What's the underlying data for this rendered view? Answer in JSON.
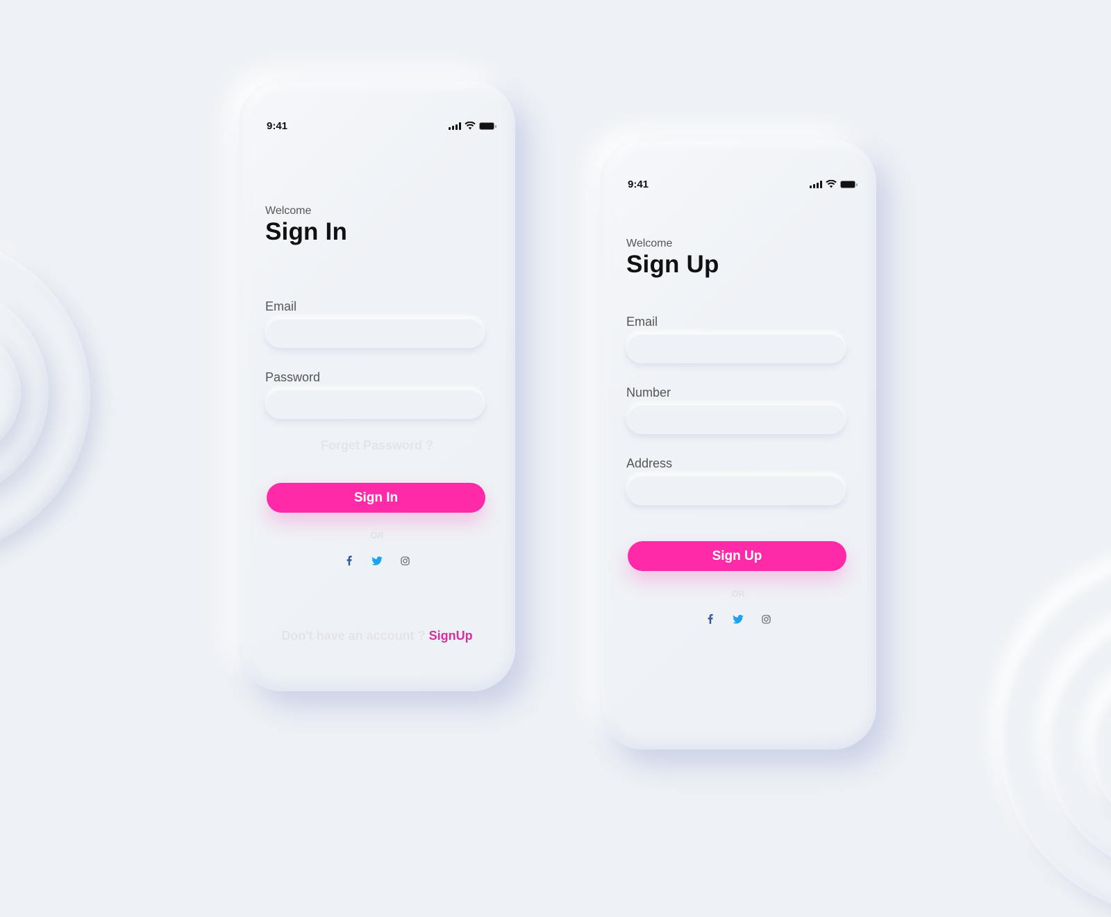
{
  "colors": {
    "accent": "#ff2aa8",
    "link": "#d4309f",
    "background": "#eef1f5",
    "facebook": "#3b5998",
    "twitter": "#1da1f2",
    "instagram": "#666666"
  },
  "signin": {
    "status_time": "9:41",
    "welcome": "Welcome",
    "title": "Sign In",
    "email_label": "Email",
    "email_value": "",
    "password_label": "Password",
    "password_value": "",
    "forgot": "Forget Password ?",
    "button": "Sign In",
    "or": "OR",
    "socials": [
      "facebook-icon",
      "twitter-icon",
      "instagram-icon"
    ],
    "footer_text": "Don't have an account ?",
    "footer_link": "SignUp"
  },
  "signup": {
    "status_time": "9:41",
    "welcome": "Welcome",
    "title": "Sign Up",
    "email_label": "Email",
    "email_value": "",
    "number_label": "Number",
    "number_value": "",
    "address_label": "Address",
    "address_value": "",
    "button": "Sign Up",
    "or": "OR",
    "socials": [
      "facebook-icon",
      "twitter-icon",
      "instagram-icon"
    ]
  }
}
